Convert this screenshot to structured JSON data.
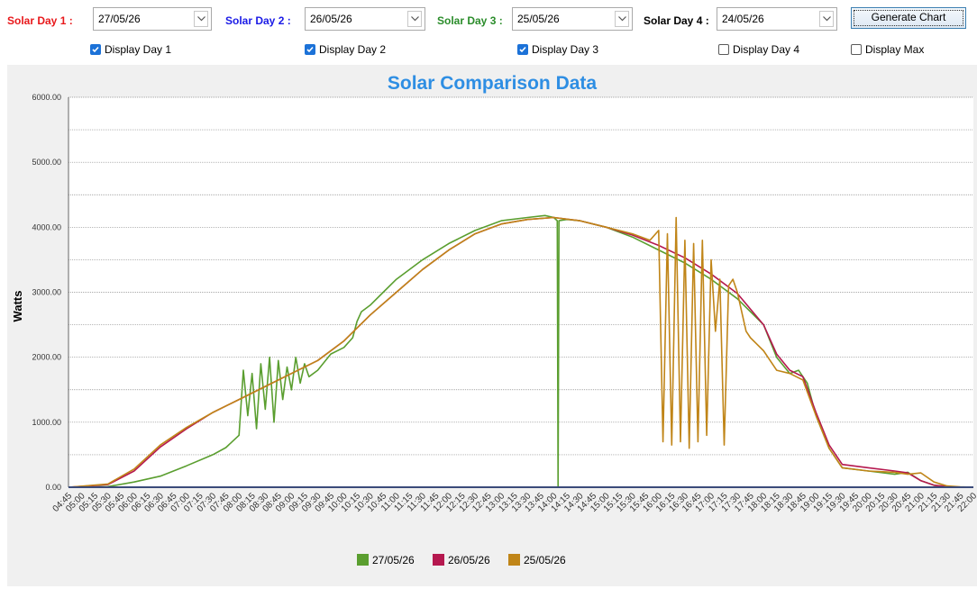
{
  "controls": {
    "day1": {
      "label": "Solar Day 1 :",
      "value": "27/05/26",
      "color": "#e8181b"
    },
    "day2": {
      "label": "Solar Day 2 :",
      "value": "26/05/26",
      "color": "#1a1ae6"
    },
    "day3": {
      "label": "Solar Day 3 :",
      "value": "25/05/26",
      "color": "#2a8c2a"
    },
    "day4": {
      "label": "Solar Day 4 :",
      "value": "24/05/26",
      "color": "#000000"
    },
    "generate_label": "Generate Chart",
    "checkboxes": [
      {
        "label": "Display Day 1",
        "checked": true
      },
      {
        "label": "Display Day 2",
        "checked": true
      },
      {
        "label": "Display Day 3",
        "checked": true
      },
      {
        "label": "Display Day 4",
        "checked": false
      },
      {
        "label": "Display Max",
        "checked": false
      }
    ]
  },
  "chart_data": {
    "type": "line",
    "title": "Solar Comparison Data",
    "ylabel": "Watts",
    "xlabel": "",
    "ylim": [
      0,
      6000
    ],
    "yticks": [
      "0.00",
      "1000.00",
      "2000.00",
      "3000.00",
      "4000.00",
      "5000.00",
      "6000.00"
    ],
    "x_ticks": [
      "04:45",
      "05:00",
      "05:15",
      "05:30",
      "05:45",
      "06:00",
      "06:15",
      "06:30",
      "06:45",
      "07:00",
      "07:15",
      "07:30",
      "07:45",
      "08:00",
      "08:15",
      "08:30",
      "08:45",
      "09:00",
      "09:15",
      "09:30",
      "09:45",
      "10:00",
      "10:15",
      "10:30",
      "10:45",
      "11:00",
      "11:15",
      "11:30",
      "11:45",
      "12:00",
      "12:15",
      "12:30",
      "12:45",
      "13:00",
      "13:15",
      "13:30",
      "13:45",
      "14:00",
      "14:15",
      "14:30",
      "14:45",
      "15:00",
      "15:15",
      "15:30",
      "15:45",
      "16:00",
      "16:15",
      "16:30",
      "16:45",
      "17:00",
      "17:15",
      "17:30",
      "17:45",
      "18:00",
      "18:15",
      "18:30",
      "18:45",
      "19:00",
      "19:15",
      "19:30",
      "19:45",
      "20:00",
      "20:15",
      "20:30",
      "20:45",
      "21:00",
      "21:15",
      "21:30",
      "21:45",
      "22:00"
    ],
    "grid": true,
    "legend_position": "bottom",
    "series": [
      {
        "name": "27/05/26",
        "color": "#5a9e2f",
        "x": [
          "04:45",
          "05:30",
          "06:00",
          "06:30",
          "07:00",
          "07:30",
          "07:45",
          "08:00",
          "08:05",
          "08:10",
          "08:15",
          "08:20",
          "08:25",
          "08:30",
          "08:35",
          "08:40",
          "08:45",
          "08:50",
          "08:55",
          "09:00",
          "09:05",
          "09:10",
          "09:15",
          "09:20",
          "09:30",
          "09:45",
          "10:00",
          "10:10",
          "10:15",
          "10:20",
          "10:30",
          "10:45",
          "11:00",
          "11:30",
          "12:00",
          "12:30",
          "13:00",
          "13:30",
          "13:50",
          "14:00",
          "14:04",
          "14:05",
          "14:06",
          "14:15",
          "14:30",
          "15:00",
          "15:30",
          "16:00",
          "16:30",
          "17:00",
          "17:30",
          "18:00",
          "18:15",
          "18:30",
          "18:40",
          "18:50",
          "19:00",
          "19:15",
          "19:30",
          "20:00",
          "20:30",
          "20:45",
          "21:00",
          "21:15",
          "21:30",
          "21:45",
          "22:00"
        ],
        "values": [
          0,
          10,
          80,
          170,
          330,
          500,
          610,
          800,
          1800,
          1100,
          1750,
          900,
          1900,
          1200,
          2000,
          1000,
          1950,
          1350,
          1850,
          1500,
          2000,
          1600,
          1900,
          1700,
          1800,
          2050,
          2150,
          2300,
          2550,
          2700,
          2800,
          3000,
          3200,
          3500,
          3750,
          3950,
          4100,
          4150,
          4180,
          4150,
          4100,
          0,
          4100,
          4120,
          4100,
          4000,
          3850,
          3650,
          3450,
          3200,
          2900,
          2500,
          2000,
          1750,
          1800,
          1600,
          1100,
          600,
          300,
          250,
          200,
          230,
          100,
          30,
          10,
          0,
          0
        ]
      },
      {
        "name": "26/05/26",
        "color": "#b5184f",
        "x": [
          "04:45",
          "05:30",
          "06:00",
          "06:30",
          "07:00",
          "07:30",
          "08:00",
          "08:30",
          "09:00",
          "09:30",
          "10:00",
          "10:30",
          "11:00",
          "11:30",
          "12:00",
          "12:30",
          "13:00",
          "13:30",
          "14:00",
          "14:30",
          "15:00",
          "15:30",
          "16:00",
          "16:30",
          "17:00",
          "17:30",
          "18:00",
          "18:15",
          "18:30",
          "18:45",
          "19:00",
          "19:15",
          "19:30",
          "20:00",
          "20:30",
          "20:45",
          "21:00",
          "21:15",
          "21:30",
          "21:45",
          "22:00"
        ],
        "values": [
          0,
          40,
          250,
          620,
          900,
          1150,
          1350,
          1550,
          1750,
          1950,
          2250,
          2650,
          3000,
          3350,
          3650,
          3900,
          4050,
          4120,
          4150,
          4100,
          4000,
          3880,
          3720,
          3530,
          3280,
          2980,
          2500,
          2050,
          1800,
          1700,
          1150,
          650,
          350,
          300,
          250,
          220,
          100,
          30,
          10,
          0,
          0
        ]
      },
      {
        "name": "25/05/26",
        "color": "#c08518",
        "x": [
          "04:45",
          "05:30",
          "06:00",
          "06:30",
          "07:00",
          "07:30",
          "08:00",
          "08:30",
          "09:00",
          "09:30",
          "10:00",
          "10:30",
          "11:00",
          "11:30",
          "12:00",
          "12:30",
          "13:00",
          "13:30",
          "14:00",
          "14:30",
          "15:00",
          "15:30",
          "15:50",
          "16:00",
          "16:05",
          "16:10",
          "16:15",
          "16:20",
          "16:25",
          "16:30",
          "16:35",
          "16:40",
          "16:45",
          "16:50",
          "16:55",
          "17:00",
          "17:05",
          "17:10",
          "17:15",
          "17:20",
          "17:25",
          "17:30",
          "17:35",
          "17:40",
          "17:45",
          "18:00",
          "18:15",
          "18:30",
          "18:45",
          "19:00",
          "19:15",
          "19:30",
          "20:00",
          "20:30",
          "20:45",
          "21:00",
          "21:15",
          "21:30",
          "21:45",
          "22:00"
        ],
        "values": [
          0,
          50,
          280,
          650,
          920,
          1150,
          1350,
          1550,
          1750,
          1950,
          2250,
          2650,
          3000,
          3350,
          3650,
          3900,
          4050,
          4120,
          4150,
          4100,
          4000,
          3900,
          3800,
          3950,
          700,
          3900,
          650,
          4150,
          700,
          3800,
          600,
          3750,
          700,
          3800,
          800,
          3500,
          2400,
          3200,
          650,
          3100,
          3200,
          3000,
          2700,
          2400,
          2300,
          2100,
          1800,
          1750,
          1650,
          1100,
          600,
          300,
          250,
          230,
          200,
          220,
          80,
          20,
          5,
          0
        ]
      }
    ]
  }
}
